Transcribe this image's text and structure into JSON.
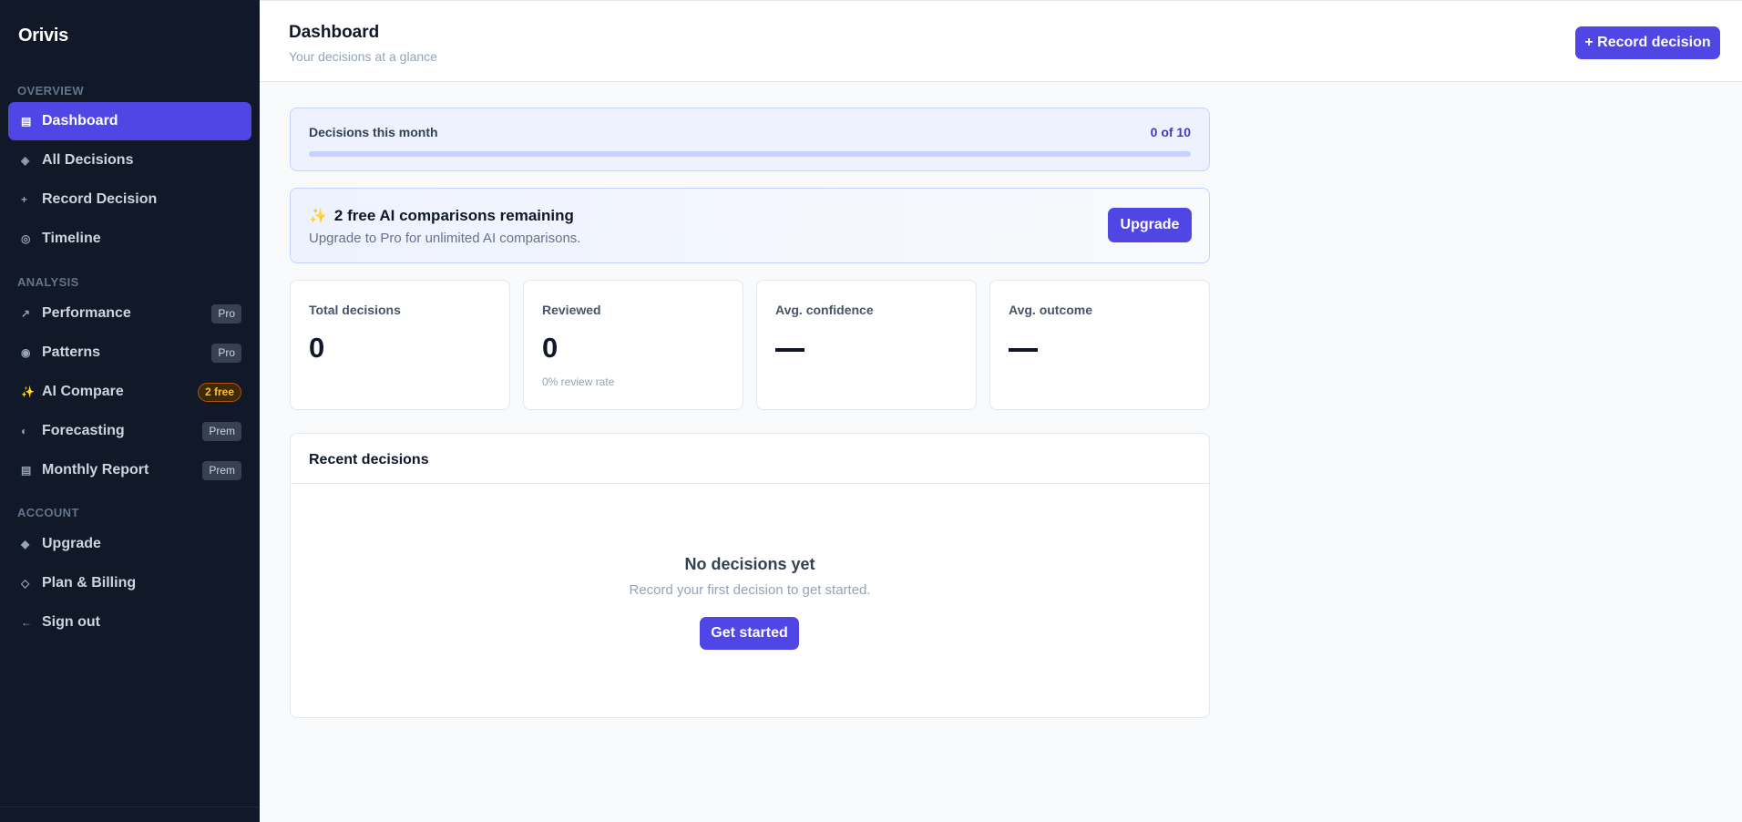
{
  "sidebar": {
    "brand": "Orivis",
    "sections": {
      "overview": "OVERVIEW",
      "analysis": "ANALYSIS",
      "account": "ACCOUNT"
    },
    "items": {
      "dashboard": {
        "label": "Dashboard",
        "icon": "dashboard-icon",
        "glyph": "▤",
        "active": true
      },
      "all_decisions": {
        "label": "All Decisions",
        "icon": "diamond-icon",
        "glyph": "◈"
      },
      "record_decision": {
        "label": "Record Decision",
        "icon": "plus-icon",
        "glyph": "+"
      },
      "timeline": {
        "label": "Timeline",
        "icon": "timeline-icon",
        "glyph": "◎"
      },
      "performance": {
        "label": "Performance",
        "icon": "trend-icon",
        "glyph": "↗",
        "badge": "Pro"
      },
      "patterns": {
        "label": "Patterns",
        "icon": "patterns-icon",
        "glyph": "◉",
        "badge": "Pro"
      },
      "ai_compare": {
        "label": "AI Compare",
        "icon": "sparkles-icon",
        "glyph": "✨",
        "badge": "2 free"
      },
      "forecasting": {
        "label": "Forecasting",
        "icon": "forecast-icon",
        "glyph": "◐",
        "badge": "Prem"
      },
      "monthly_report": {
        "label": "Monthly Report",
        "icon": "report-icon",
        "glyph": "▤",
        "badge": "Prem"
      },
      "upgrade": {
        "label": "Upgrade",
        "icon": "upgrade-icon",
        "glyph": "◆"
      },
      "plan_billing": {
        "label": "Plan & Billing",
        "icon": "billing-icon",
        "glyph": "◇"
      },
      "sign_out": {
        "label": "Sign out",
        "icon": "arrow-left-icon",
        "glyph": "←"
      }
    }
  },
  "header": {
    "title": "Dashboard",
    "subtitle": "Your decisions at a glance",
    "record_button": "+ Record decision"
  },
  "quota": {
    "label": "Decisions this month",
    "value": "0 of 10",
    "used": 0,
    "limit": 10
  },
  "ai_banner": {
    "icon": "sparkles-icon",
    "title": "2 free AI comparisons remaining",
    "subtitle": "Upgrade to Pro for unlimited AI comparisons.",
    "button": "Upgrade"
  },
  "stats": [
    {
      "label": "Total decisions",
      "value": "0"
    },
    {
      "label": "Reviewed",
      "value": "0",
      "note": "0% review rate"
    },
    {
      "label": "Avg. confidence",
      "value": "—"
    },
    {
      "label": "Avg. outcome",
      "value": "—"
    }
  ],
  "recent": {
    "title": "Recent decisions",
    "empty_title": "No decisions yet",
    "empty_subtitle": "Record your first decision to get started.",
    "button": "Get started"
  },
  "colors": {
    "accent": "#4f46e5",
    "sidebar_bg": "#111827",
    "free_badge": "#fbbf24"
  }
}
